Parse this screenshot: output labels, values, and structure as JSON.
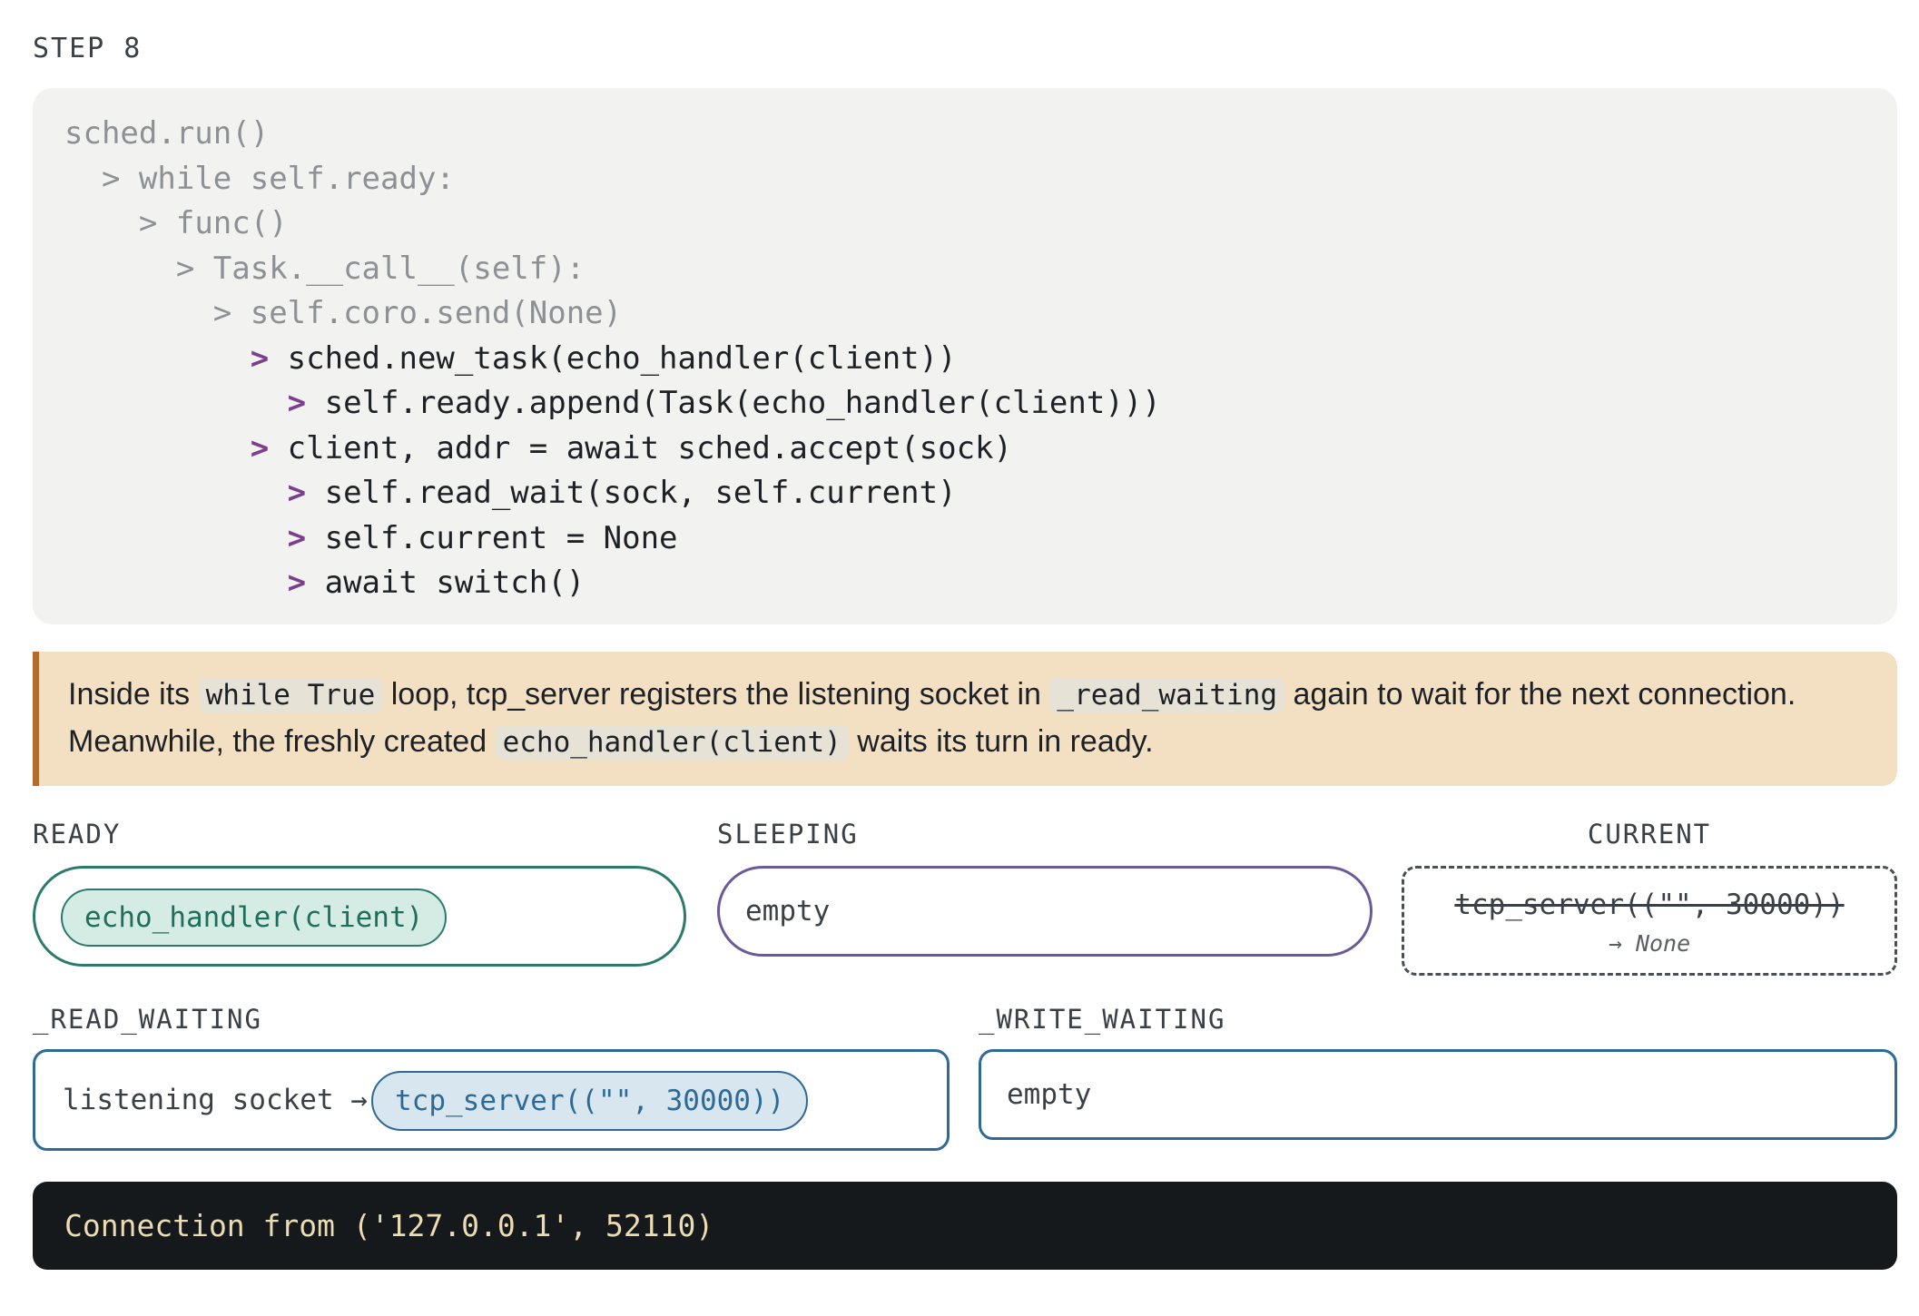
{
  "step_label": "STEP 8",
  "code": [
    {
      "arrow": "",
      "text": "sched.run()",
      "state": "dim"
    },
    {
      "arrow": "> ",
      "text": "while self.ready:",
      "state": "dim"
    },
    {
      "arrow": "> ",
      "text": "func()",
      "state": "dim"
    },
    {
      "arrow": "> ",
      "text": "Task.__call__(self):",
      "state": "dim"
    },
    {
      "arrow": "> ",
      "text": "self.coro.send(None)",
      "state": "dim"
    },
    {
      "arrow": "> ",
      "text": "sched.new_task(echo_handler(client))",
      "state": "active"
    },
    {
      "arrow": "> ",
      "text": "self.ready.append(Task(echo_handler(client)))",
      "state": "active"
    },
    {
      "arrow": "> ",
      "text": "client, addr = await sched.accept(sock)",
      "state": "active"
    },
    {
      "arrow": "> ",
      "text": "self.read_wait(sock, self.current)",
      "state": "active"
    },
    {
      "arrow": "> ",
      "text": "self.current = None",
      "state": "active"
    },
    {
      "arrow": "> ",
      "text": "await switch()",
      "state": "active"
    }
  ],
  "note": {
    "t1": "Inside its ",
    "c1": "while True",
    "t2": " loop, tcp_server registers the listening socket in ",
    "c2": "_read_waiting",
    "t3": " again to wait for the next connection. Meanwhile, the freshly created ",
    "c3": "echo_handler(client)",
    "t4": " waits its turn in ready."
  },
  "ready": {
    "label": "READY",
    "items": [
      "echo_handler(client)"
    ]
  },
  "sleeping": {
    "label": "SLEEPING",
    "value": "empty"
  },
  "current": {
    "label": "CURRENT",
    "struck": "tcp_server((\"\", 30000))",
    "note": "→ None"
  },
  "read_waiting": {
    "label": "_READ_WAITING",
    "key": "listening socket →",
    "task": "tcp_server((\"\", 30000))"
  },
  "write_waiting": {
    "label": "_WRITE_WAITING",
    "value": "empty"
  },
  "terminal": {
    "output": "Connection from ('127.0.0.1', 52110)"
  },
  "colors": {
    "arrow_active": "#7b3f8c",
    "ready_accent": "#2b7a6b",
    "sleeping_accent": "#6a5a9a",
    "waiting_accent": "#2e6a95",
    "note_accent": "#b56b2e",
    "note_background": "#f3e0c3",
    "terminal_background": "#15191c",
    "terminal_text": "#ecdcb3"
  }
}
